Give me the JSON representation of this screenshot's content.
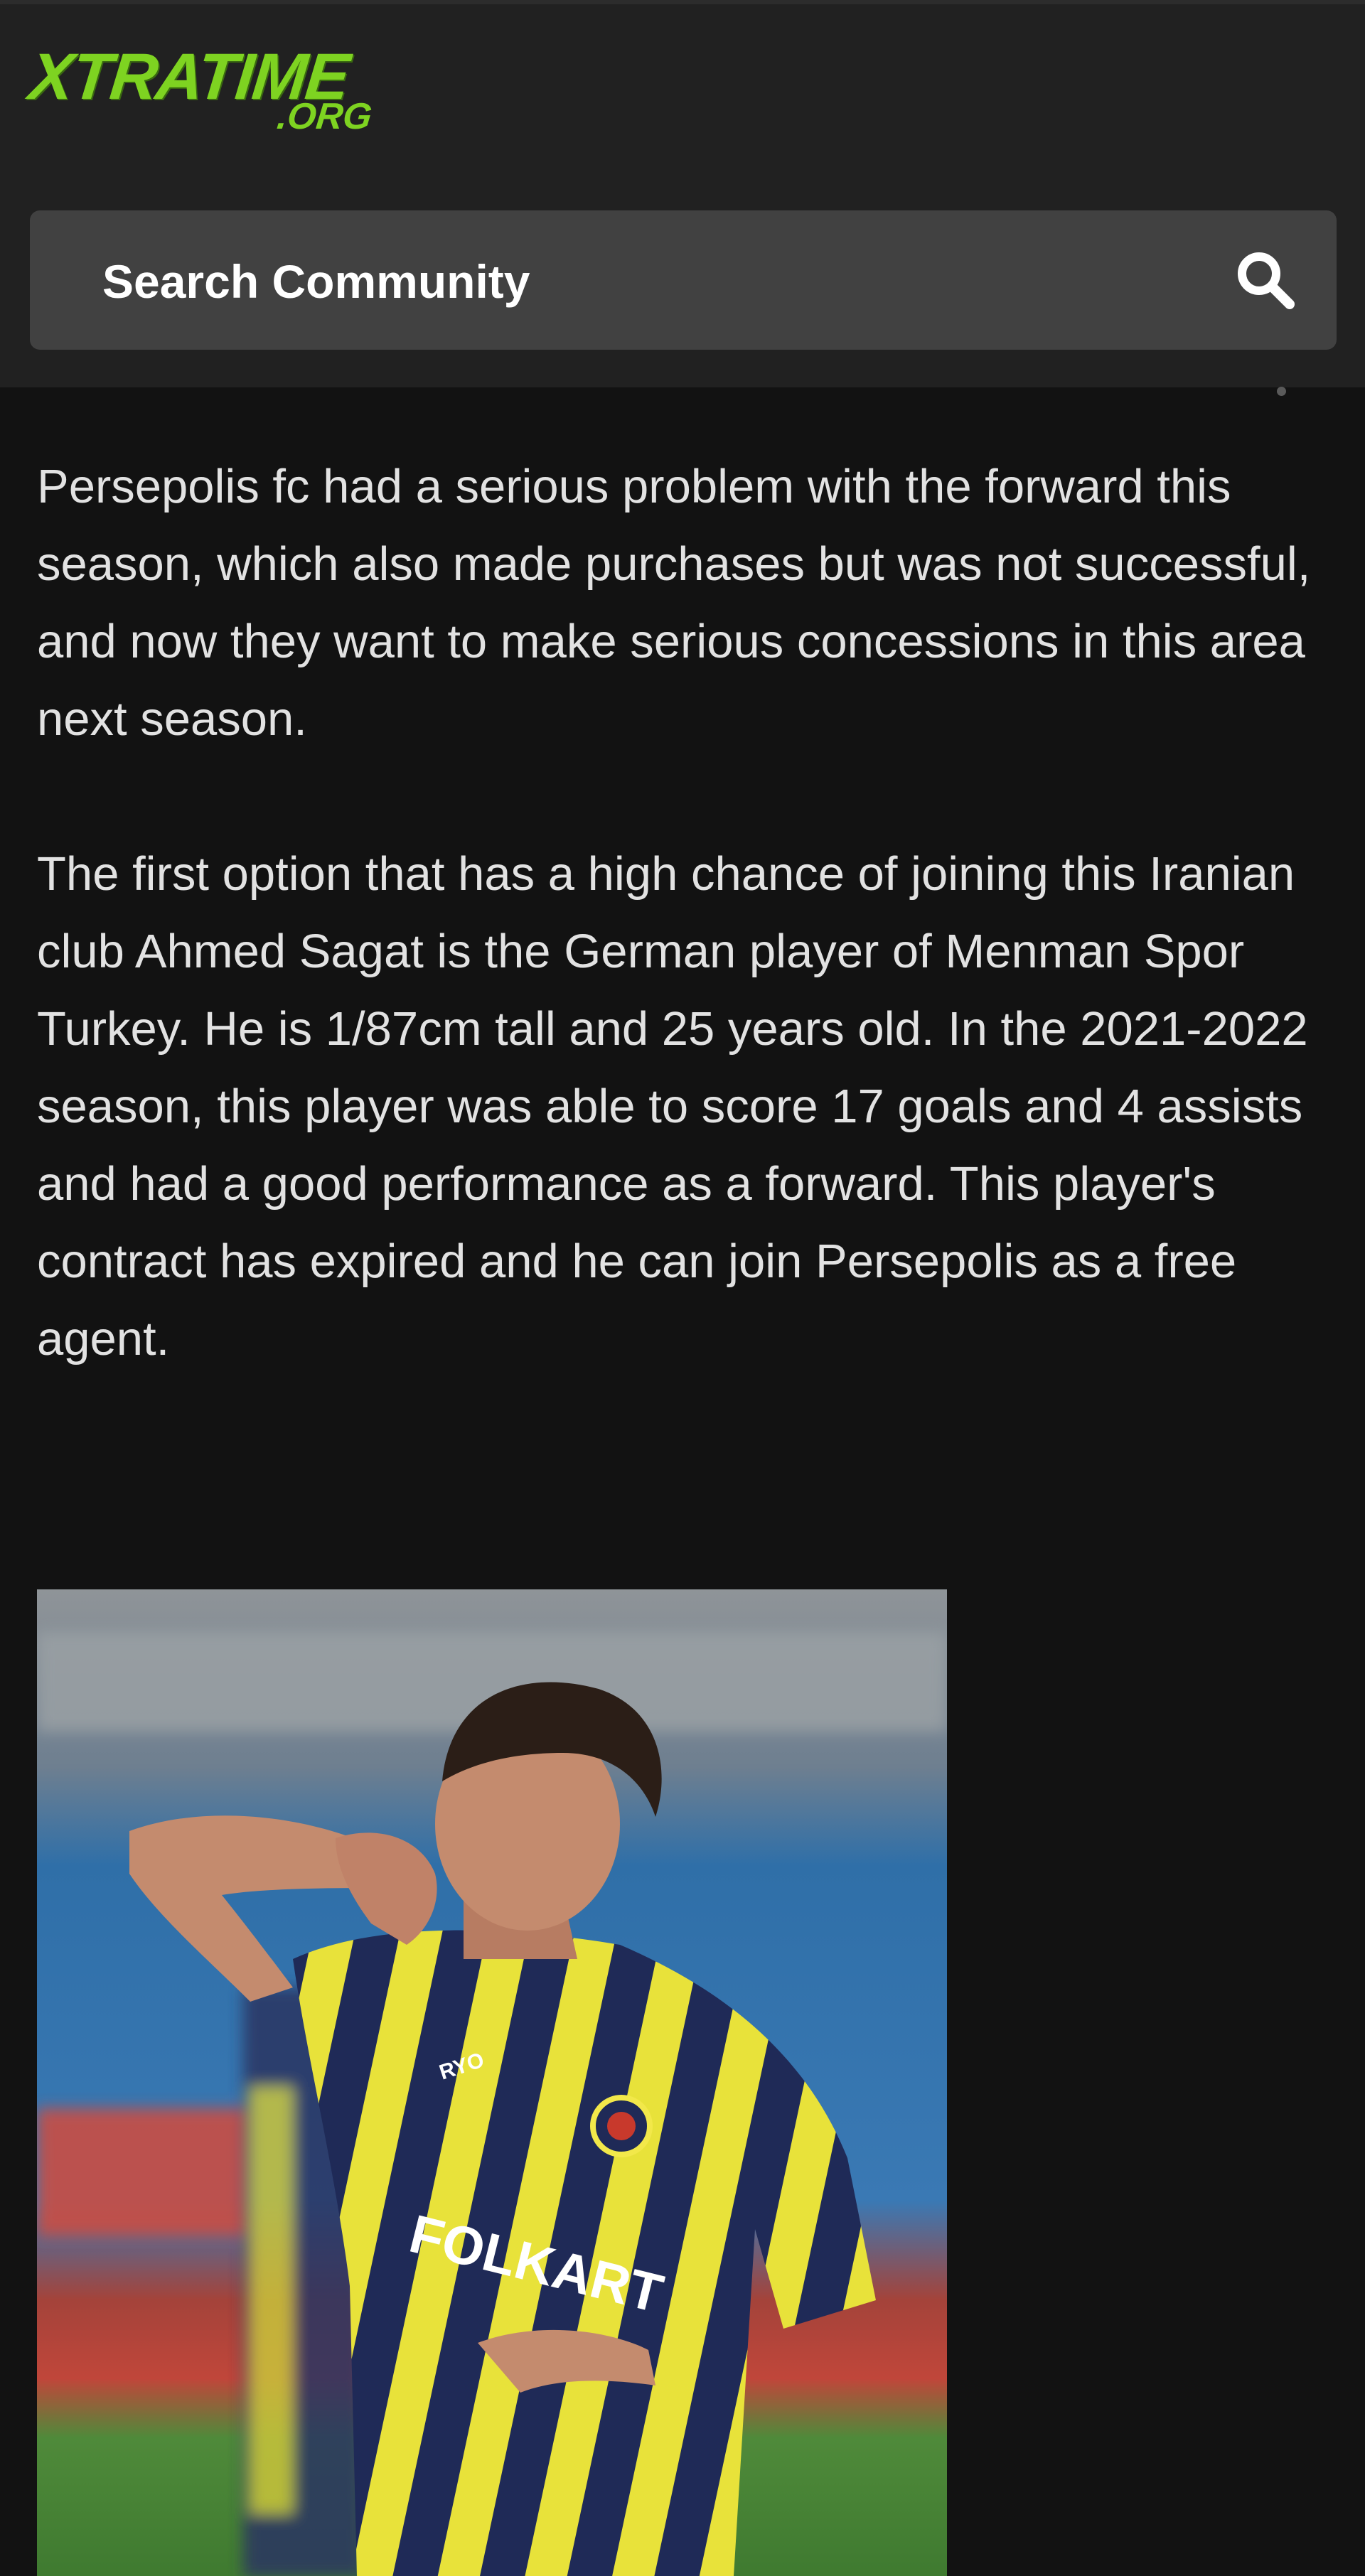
{
  "header": {
    "logo_main": "XTRATIME",
    "logo_sub": ".ORG"
  },
  "search": {
    "label": "Search Community",
    "icon": "search-icon"
  },
  "article": {
    "paragraphs": [
      "Persepolis fc had a serious problem with the forward this season, which also made purchases but was not successful, and now they want to make serious concessions in this area next season.",
      "The first option that has a high chance of joining this Iranian club Ahmed Sagat is the German player of Menman Spor Turkey. He is 1/87cm tall and 25 years old. In the 2021-2022 season, this player was able to score 17 goals and 4 assists and had a good performance as a forward. This player's contract has expired and he can join Persepolis as a free agent."
    ],
    "photo": {
      "jersey_brand": "RYO",
      "jersey_sponsor": "FOLKART"
    }
  },
  "colors": {
    "brand_green": "#7ed321",
    "header_bg": "#212121",
    "page_bg": "#121212",
    "search_bg": "#414141",
    "text": "#e2e2e2"
  }
}
